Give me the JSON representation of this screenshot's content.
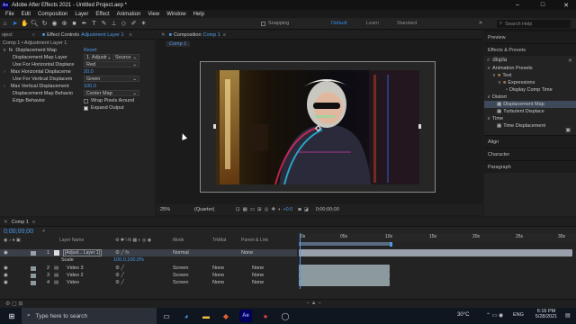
{
  "app": {
    "title": "Adobe After Effects 2021 - Untitled Project.aep *",
    "logo": "Ae"
  },
  "window_controls": {
    "minimize": "–",
    "maximize": "□",
    "close": "✕"
  },
  "menu": [
    "File",
    "Edit",
    "Composition",
    "Layer",
    "Effect",
    "Animation",
    "View",
    "Window",
    "Help"
  ],
  "toolbar": {
    "snapping": "Snapping",
    "workspaces": [
      "Default",
      "Learn",
      "Standard"
    ],
    "search_placeholder": "Search Help"
  },
  "project_panel": {
    "tab": "oject"
  },
  "effect_controls": {
    "tab_label": "Effect Controls",
    "tab_layer": "Adjustment Layer 1",
    "breadcrumb": "Comp 1 • Adjustment Layer 1",
    "effect_name": "Displacement Map",
    "reset": "Reset",
    "props": [
      {
        "label": "Displacement Map Layer",
        "value": "1. Adjustr",
        "extra": "Source"
      },
      {
        "label": "Use For Horizontal Displace",
        "value": "Red"
      },
      {
        "label": "Max Horizontal Displaceme",
        "value": "20.0"
      },
      {
        "label": "Use For Vertical Displacem",
        "value": "Green"
      },
      {
        "label": "Max Vertical Displacement",
        "value": "100.0"
      },
      {
        "label": "Displacement Map Behavio",
        "value": "Center Map"
      },
      {
        "label": "Edge Behavior",
        "value": ""
      }
    ],
    "checkboxes": [
      {
        "label": "Wrap Pixels Around",
        "checked": false
      },
      {
        "label": "Expand Output",
        "checked": true
      }
    ]
  },
  "composition": {
    "tab_label": "Composition",
    "tab_name": "Comp 1",
    "sub_tab": "Comp 1",
    "zoom": "25%",
    "resolution": "(Quarter)",
    "exposure": "+0.0",
    "timecode": "0;00;00;00"
  },
  "right_panel": {
    "preview": "Preview",
    "effects_presets": "Effects & Presets",
    "search_value": "displa",
    "tree": [
      {
        "label": "Animation Presets",
        "indent": 0,
        "type": "folder"
      },
      {
        "label": "Text",
        "indent": 1,
        "type": "folder"
      },
      {
        "label": "Expressions",
        "indent": 2,
        "type": "folder"
      },
      {
        "label": "Display Comp Time",
        "indent": 3,
        "type": "preset"
      },
      {
        "label": "Distort",
        "indent": 0,
        "type": "folder"
      },
      {
        "label": "Displacement Map",
        "indent": 1,
        "type": "effect",
        "selected": true
      },
      {
        "label": "Turbulent Displace",
        "indent": 1,
        "type": "effect"
      },
      {
        "label": "Time",
        "indent": 0,
        "type": "folder"
      },
      {
        "label": "Time Displacement",
        "indent": 1,
        "type": "effect"
      }
    ],
    "sections": [
      "Align",
      "Character",
      "Paragraph"
    ]
  },
  "timeline": {
    "tab": "Comp 1",
    "timecode": "0;00;00;00",
    "search_placeholder": "",
    "columns": {
      "layer_name": "Layer Name",
      "mode": "Mode",
      "trkmat": "TrkMat",
      "parent": "Parent & Link"
    },
    "ruler": [
      "0s",
      "05s",
      "10s",
      "15s",
      "20s",
      "25s",
      "30s"
    ],
    "layers": [
      {
        "num": "1",
        "name": "[Adjust... Layer 1]",
        "mode": "Normal",
        "trkmat": "",
        "parent": "None",
        "selected": true
      },
      {
        "num": "",
        "name": "Scale",
        "mode": "",
        "trkmat": "",
        "parent": "",
        "prop_value": "100.0,100.0%"
      },
      {
        "num": "2",
        "name": "Video 3",
        "mode": "Screen",
        "trkmat": "None",
        "parent": "None"
      },
      {
        "num": "3",
        "name": "Video 2",
        "mode": "Screen",
        "trkmat": "None",
        "parent": "None"
      },
      {
        "num": "4",
        "name": "Video",
        "mode": "Screen",
        "trkmat": "None",
        "parent": "None"
      }
    ]
  },
  "taskbar": {
    "search_placeholder": "Type here to search",
    "temperature": "30°C",
    "lang": "ENG",
    "time": "6:16 PM",
    "date": "5/28/2021"
  },
  "colors": {
    "accent": "#2d8ceb",
    "adjust_track": "#9aa0aa",
    "video_track": "#8c9aa0",
    "selected_fx": "#3e4a5a"
  }
}
